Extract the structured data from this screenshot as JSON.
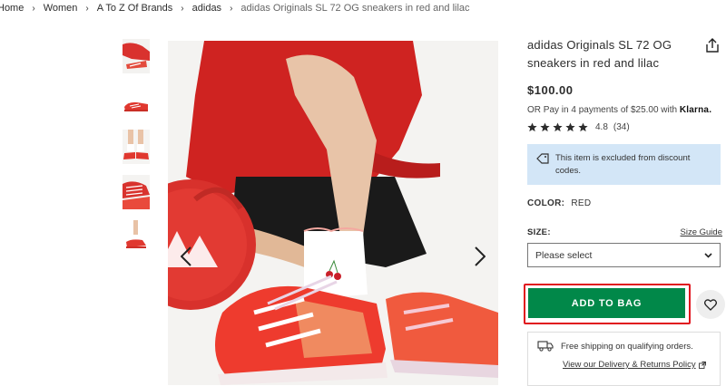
{
  "breadcrumb": {
    "items": [
      "Home",
      "Women",
      "A To Z Of Brands",
      "adidas"
    ],
    "current": "adidas Originals SL 72 OG sneakers in red and lilac",
    "separator": "›"
  },
  "gallery": {
    "thumbnails": [
      {
        "icon": "product-thumbnail-1"
      },
      {
        "icon": "product-thumbnail-2"
      },
      {
        "icon": "product-thumbnail-3"
      },
      {
        "icon": "product-thumbnail-4"
      },
      {
        "icon": "product-thumbnail-5"
      }
    ],
    "main_image": "model-sitting-wearing-red-adidas-sneakers",
    "prev_icon": "chevron-left-icon",
    "next_icon": "chevron-right-icon"
  },
  "product": {
    "title": "adidas Originals SL 72 OG sneakers in red and lilac",
    "price": "$100.00",
    "pay_prefix": "OR Pay in 4 payments of $25.00 with",
    "pay_brand": "Klarna.",
    "rating": {
      "stars": 5,
      "score": "4.8",
      "count": "(34)"
    },
    "discount_note": "This item is excluded from discount codes.",
    "color_label": "COLOR:",
    "color_value": "RED",
    "size_label": "SIZE:",
    "size_guide": "Size Guide",
    "size_select_value": "Please select",
    "add_to_bag": "ADD TO BAG",
    "shipping_text": "Free shipping on qualifying orders.",
    "returns_link": "View our Delivery & Returns Policy"
  },
  "colors": {
    "accent_green": "#018849",
    "highlight_red": "#e0141e",
    "info_blue": "#d3e6f7"
  }
}
